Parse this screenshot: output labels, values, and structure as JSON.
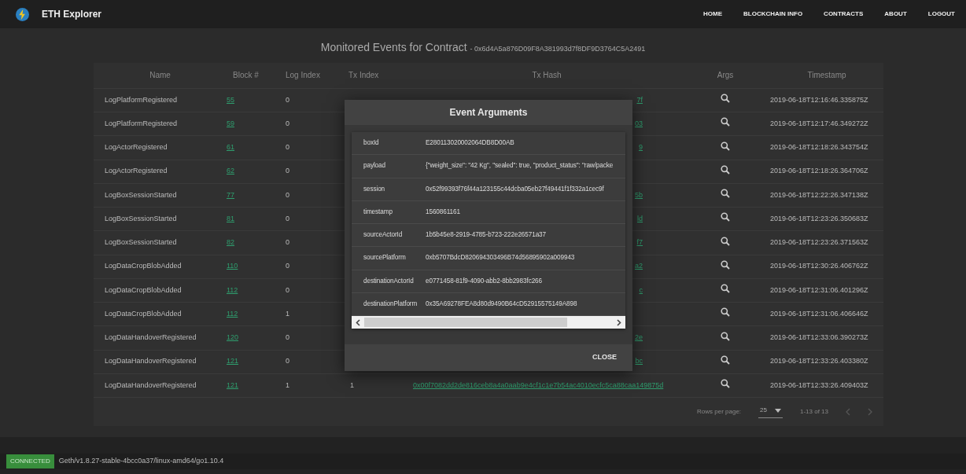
{
  "navbar": {
    "brand": "ETH Explorer",
    "links": [
      {
        "label": "HOME"
      },
      {
        "label": "BLOCKCHAIN INFO"
      },
      {
        "label": "CONTRACTS"
      },
      {
        "label": "ABOUT"
      },
      {
        "label": "LOGOUT"
      }
    ]
  },
  "page": {
    "title": "Monitored Events for Contract",
    "contract": "- 0x6d4A5a876D09F8A381993d7f8DF9D3764C5A2491"
  },
  "table": {
    "columns": [
      "Name",
      "Block #",
      "Log Index",
      "Tx Index",
      "Tx Hash",
      "Args",
      "Timestamp"
    ],
    "rows": [
      {
        "name": "LogPlatformRegistered",
        "block": "55",
        "log_index": "0",
        "tx_hash": "7f",
        "timestamp": "2019-06-18T12:16:46.335875Z"
      },
      {
        "name": "LogPlatformRegistered",
        "block": "59",
        "log_index": "0",
        "tx_hash": "03",
        "timestamp": "2019-06-18T12:17:46.349272Z"
      },
      {
        "name": "LogActorRegistered",
        "block": "61",
        "log_index": "0",
        "tx_hash": "9",
        "timestamp": "2019-06-18T12:18:26.343754Z"
      },
      {
        "name": "LogActorRegistered",
        "block": "62",
        "log_index": "0",
        "timestamp": "2019-06-18T12:18:26.364706Z"
      },
      {
        "name": "LogBoxSessionStarted",
        "block": "77",
        "log_index": "0",
        "tx_hash": "5b",
        "timestamp": "2019-06-18T12:22:26.347138Z"
      },
      {
        "name": "LogBoxSessionStarted",
        "block": "81",
        "log_index": "0",
        "tx_hash": "ld",
        "timestamp": "2019-06-18T12:23:26.350683Z"
      },
      {
        "name": "LogBoxSessionStarted",
        "block": "82",
        "log_index": "0",
        "tx_hash": "f7",
        "timestamp": "2019-06-18T12:23:26.371563Z"
      },
      {
        "name": "LogDataCropBlobAdded",
        "block": "110",
        "log_index": "0",
        "tx_hash": "a2",
        "timestamp": "2019-06-18T12:30:26.406762Z"
      },
      {
        "name": "LogDataCropBlobAdded",
        "block": "112",
        "log_index": "0",
        "tx_hash": "c",
        "timestamp": "2019-06-18T12:31:06.401296Z"
      },
      {
        "name": "LogDataCropBlobAdded",
        "block": "112",
        "log_index": "1",
        "timestamp": "2019-06-18T12:31:06.406646Z"
      },
      {
        "name": "LogDataHandoverRegistered",
        "block": "120",
        "log_index": "0",
        "tx_hash": "2e",
        "timestamp": "2019-06-18T12:33:06.390273Z"
      },
      {
        "name": "LogDataHandoverRegistered",
        "block": "121",
        "log_index": "0",
        "tx_hash": "bc",
        "timestamp": "2019-06-18T12:33:26.403380Z"
      },
      {
        "name": "LogDataHandoverRegistered",
        "block": "121",
        "log_index": "1",
        "tx_index": "1",
        "tx_hash": "0x00f7082dd2de816ceb8a4a0aab9e4cf1c1e7b54ac4010ecfc5ca88caa149875d",
        "timestamp": "2019-06-18T12:33:26.409403Z"
      }
    ]
  },
  "pagination": {
    "rows_per_page_label": "Rows per page:",
    "rows_per_page": "25",
    "range": "1-13 of 13"
  },
  "modal": {
    "title": "Event Arguments",
    "arguments": [
      {
        "key": "boxId",
        "value": "E280113020002064DB8D00AB"
      },
      {
        "key": "payload",
        "value": "{\"weight_size\": \"42 Kg\", \"sealed\": true, \"product_status\": \"raw/packe"
      },
      {
        "key": "session",
        "value": "0x52f99393f76f44a123155c44dcba05eb27f49441f1f332a1cec9f"
      },
      {
        "key": "timestamp",
        "value": "1560861161"
      },
      {
        "key": "sourceActorId",
        "value": "1b5b45e8-2919-4785-b723-222e26571a37"
      },
      {
        "key": "sourcePlatform",
        "value": "0xb5707BdcD820694303496B74d56895902a009943"
      },
      {
        "key": "destinationActorId",
        "value": "e0771458-81f9-4090-abb2-8bb2983fc266"
      },
      {
        "key": "destinationPlatform",
        "value": "0x35A69278FEA8d80d9490B64cD52915575149A898"
      }
    ],
    "close_label": "CLOSE"
  },
  "status_bar": {
    "state": "CONNECTED",
    "client": "Geth/v1.8.27-stable-4bcc0a37/linux-amd64/go1.10.4"
  }
}
